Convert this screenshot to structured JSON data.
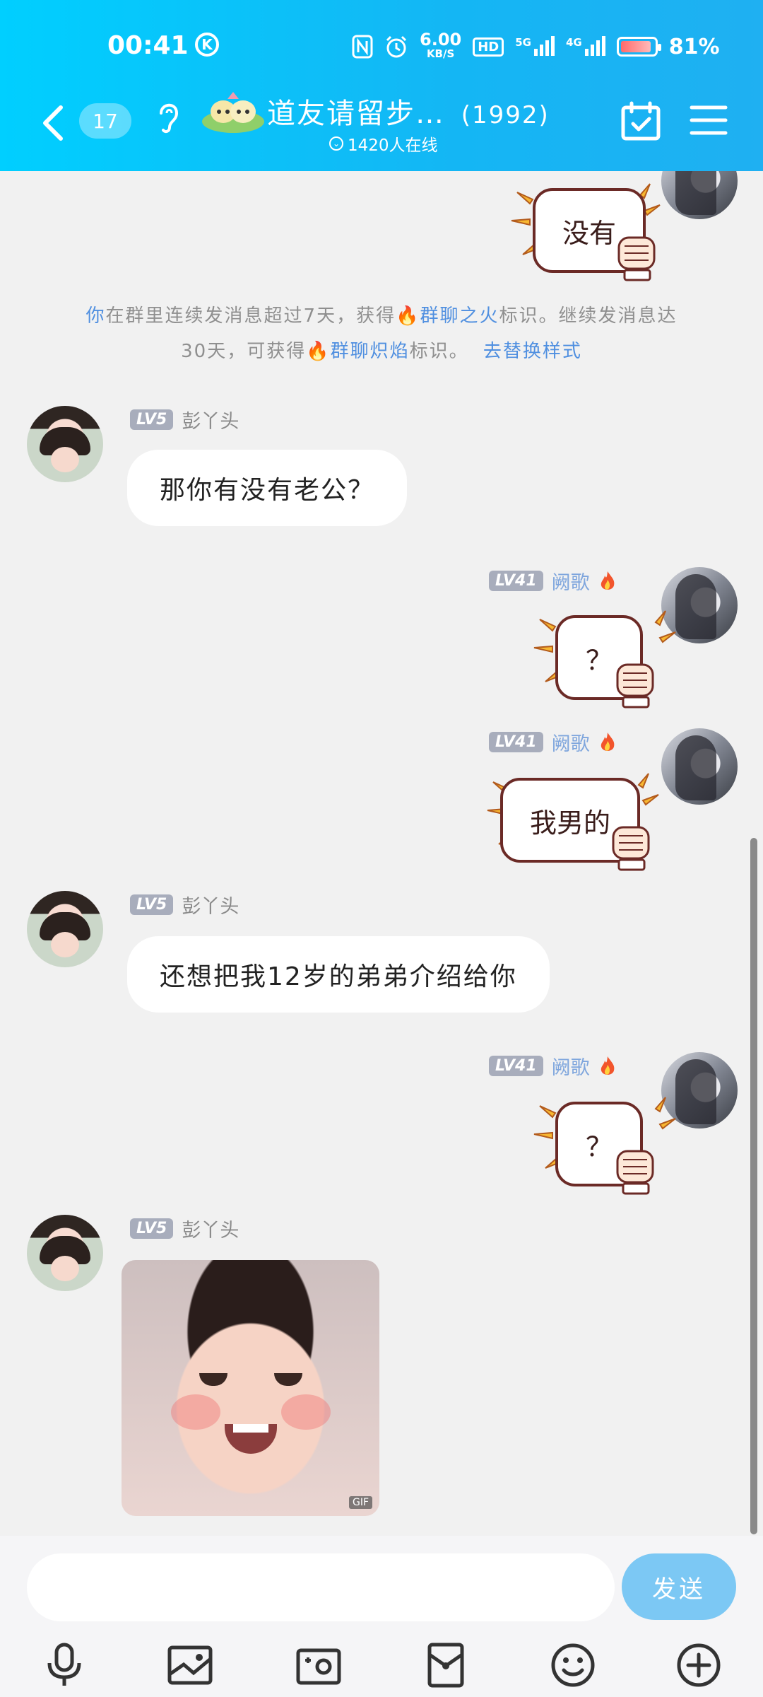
{
  "status_bar": {
    "time": "00:41",
    "k_icon": "K",
    "speed_value": "6.00",
    "speed_unit": "KB/S",
    "hd_label": "HD",
    "net1": "5G",
    "net2": "4G",
    "battery": "81%",
    "battery_level": 0.81
  },
  "header": {
    "unread_count": "17",
    "group_title": "道友请留步…",
    "member_count": "(1992)",
    "online_text": "1420人在线",
    "colors": {
      "gradient_start": "#00cfff",
      "gradient_end": "#1fb0f2"
    }
  },
  "messages": [
    {
      "side": "right",
      "type": "punch_sticker",
      "text": "没有"
    },
    {
      "type": "system_tip",
      "line1_prefix": "你",
      "line1_mid": "在群里连续发消息超过7天，获得",
      "line1_link": "群聊之火",
      "line1_suffix": "标识。继续发消息达",
      "line2_prefix": "30天，可获得",
      "line2_link": "群聊炽焰",
      "line2_suffix": "标识。",
      "line2_action": "去替换样式"
    },
    {
      "side": "left",
      "level": "LV5",
      "nickname": "彭丫头",
      "text": "那你有没有老公？"
    },
    {
      "side": "right",
      "level": "LV41",
      "nickname": "阙歌",
      "type": "punch_sticker",
      "text": "？"
    },
    {
      "side": "right",
      "level": "LV41",
      "nickname": "阙歌",
      "type": "punch_sticker",
      "text": "我男的"
    },
    {
      "side": "left",
      "level": "LV5",
      "nickname": "彭丫头",
      "text": "还想把我12岁的弟弟介绍给你"
    },
    {
      "side": "right",
      "level": "LV41",
      "nickname": "阙歌",
      "type": "punch_sticker",
      "text": "？"
    },
    {
      "side": "left",
      "level": "LV5",
      "nickname": "彭丫头",
      "type": "image",
      "badge": "GIF"
    }
  ],
  "input": {
    "placeholder": "",
    "send_label": "发送"
  },
  "toolbar": {
    "items": [
      "microphone-icon",
      "photo-icon",
      "camera-icon",
      "red-packet-icon",
      "emoji-icon",
      "plus-icon"
    ]
  }
}
